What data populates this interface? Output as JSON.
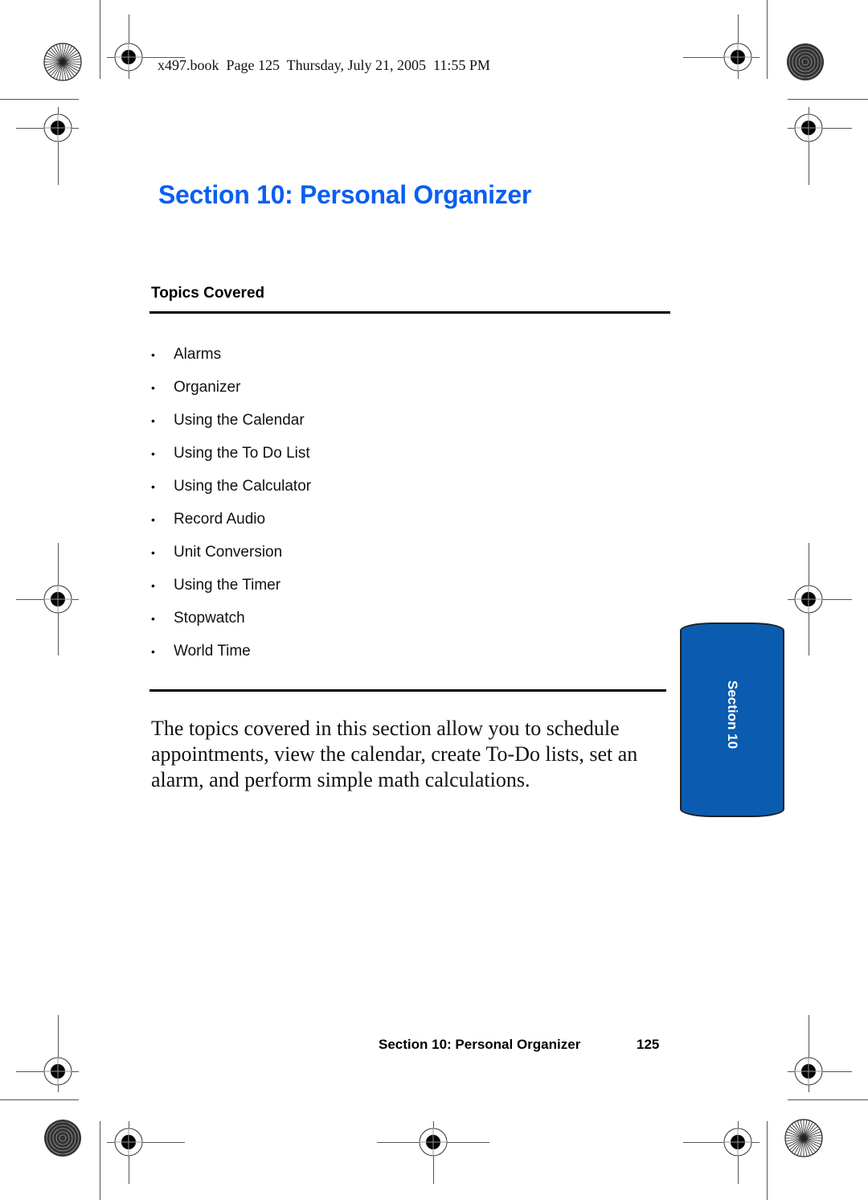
{
  "slug_line": "x497.book  Page 125  Thursday, July 21, 2005  11:55 PM",
  "page_title": "Section 10: Personal Organizer",
  "topics": {
    "heading": "Topics Covered",
    "bullet_glyph": "•",
    "items": [
      "Alarms",
      "Organizer",
      "Using the Calendar",
      "Using the To Do List",
      "Using the Calculator",
      "Record Audio",
      "Unit Conversion",
      "Using the Timer",
      "Stopwatch",
      "World Time"
    ]
  },
  "intro_paragraph": "The topics covered in this section allow you to schedule appointments, view the calendar, create To-Do lists, set an alarm, and perform simple math calculations.",
  "side_tab": {
    "label": "Section 10",
    "color": "#0b5cb0"
  },
  "footer": {
    "section_title": "Section 10: Personal Organizer",
    "page_number": "125"
  },
  "colors": {
    "title": "#0a5ff0",
    "text": "#111111"
  }
}
